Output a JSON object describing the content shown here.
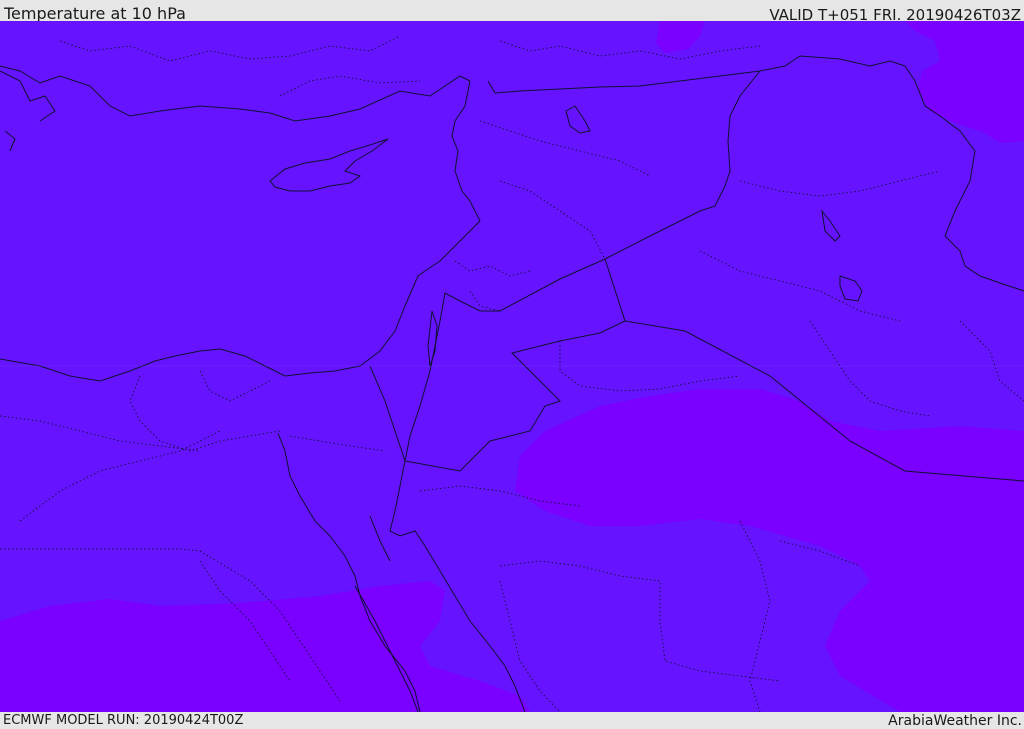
{
  "header": {
    "title": "Temperature at 10 hPa",
    "valid": "VALID T+051 FRI. 20190426T03Z"
  },
  "footer": {
    "model_run": "ECMWF MODEL RUN: 20190424T00Z",
    "credit": "ArabiaWeather Inc."
  },
  "map": {
    "colors": {
      "base_fill": "#6614ff",
      "warm_fill": "#7a00ff",
      "border": "#111133",
      "coast": "#111133"
    }
  }
}
